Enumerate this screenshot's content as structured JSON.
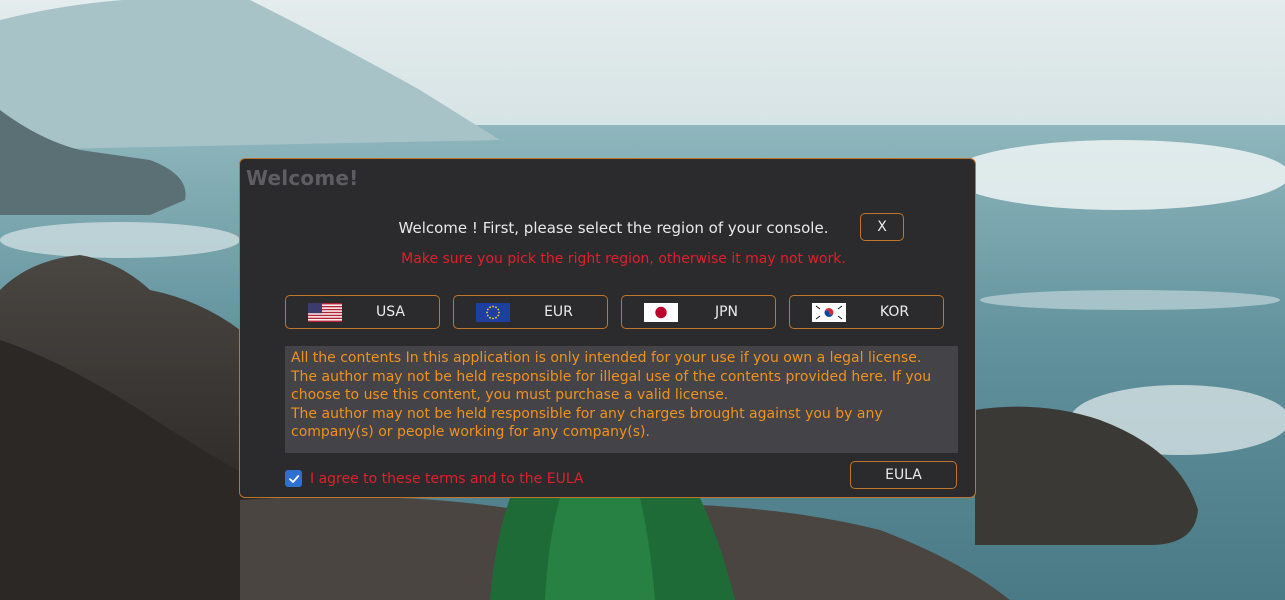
{
  "dialog": {
    "title": "Welcome!",
    "prompt": "Welcome ! First, please select the region of your console.",
    "warning": "Make sure you pick the right region, otherwise it may not work.",
    "close_label": "X",
    "regions": [
      {
        "label": "USA",
        "flag": "usa-flag-icon"
      },
      {
        "label": "EUR",
        "flag": "eu-flag-icon"
      },
      {
        "label": "JPN",
        "flag": "japan-flag-icon"
      },
      {
        "label": "KOR",
        "flag": "korea-flag-icon"
      }
    ],
    "disclaimer": [
      "All the contents In this application is only intended for your use if you own a legal license.",
      "The author may not be held responsible for illegal use of the contents provided here. If you choose to use this content, you must purchase a valid license.",
      "The author may not be held responsible for any charges brought against you by any company(s) or people working for any company(s)."
    ],
    "agree_label": "I agree to these terms and to the EULA",
    "agree_checked": true,
    "eula_label": "EULA"
  },
  "colors": {
    "dialog_bg": "#2b2a2d",
    "accent_border": "#c0752c",
    "warning_red": "#e0202a",
    "disclaimer_orange": "#f0921e",
    "checkbox_blue": "#2f6fd0"
  }
}
